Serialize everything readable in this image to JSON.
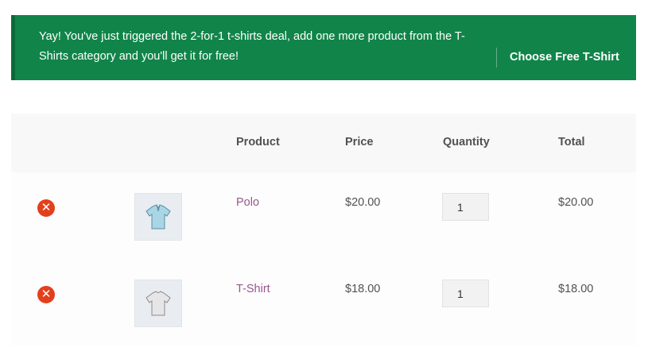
{
  "notice": {
    "message": "Yay! You've just triggered the 2-for-1 t-shirts deal, add one more product from the T-Shirts category and you'll get it for free!",
    "button_label": "Choose Free T-Shirt",
    "background_color": "#118449"
  },
  "cart": {
    "headers": {
      "remove": "",
      "thumbnail": "",
      "product": "Product",
      "price": "Price",
      "quantity": "Quantity",
      "total": "Total"
    },
    "items": [
      {
        "name": "Polo",
        "price": "$20.00",
        "quantity": "1",
        "total": "$20.00",
        "remove_icon": "close-circle-icon",
        "thumbnail_icon": "polo-shirt-icon"
      },
      {
        "name": "T-Shirt",
        "price": "$18.00",
        "quantity": "1",
        "total": "$18.00",
        "remove_icon": "close-circle-icon",
        "thumbnail_icon": "t-shirt-icon"
      }
    ],
    "link_color": "#96588a",
    "remove_color": "#e2401c"
  }
}
